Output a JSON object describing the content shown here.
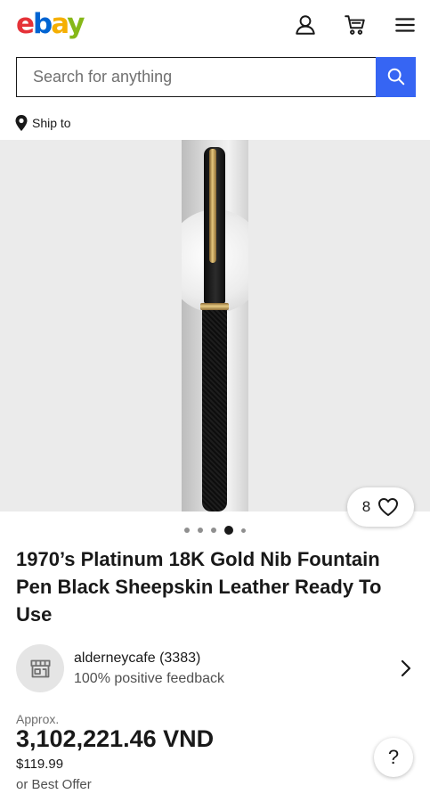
{
  "header": {
    "logo": {
      "e": "e",
      "b": "b",
      "a": "a",
      "y": "y"
    },
    "icons": [
      "account-icon",
      "cart-icon",
      "menu-icon"
    ]
  },
  "search": {
    "placeholder": "Search for anything",
    "value": ""
  },
  "ship": {
    "label": "Ship to"
  },
  "gallery": {
    "image_count": 5,
    "active_index": 4,
    "watchers": "8"
  },
  "listing": {
    "title": "1970’s Platinum 18K Gold Nib Fountain Pen Black Sheepskin Leather Ready To Use"
  },
  "seller": {
    "name": "alderneycafe (3383)",
    "feedback": "100% positive feedback"
  },
  "price": {
    "approx_label": "Approx.",
    "converted": "3,102,221.46 VND",
    "original": "$119.99",
    "best_offer": "or Best Offer"
  },
  "help": {
    "label": "?"
  },
  "colors": {
    "ebay_red": "#e53238",
    "ebay_blue": "#0064d2",
    "ebay_yellow": "#f5af02",
    "ebay_green": "#86b817",
    "search_button": "#3665f3"
  }
}
